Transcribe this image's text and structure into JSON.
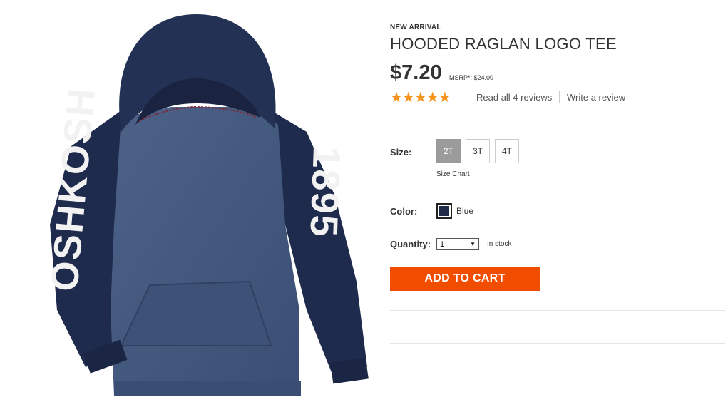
{
  "product": {
    "badge": "NEW ARRIVAL",
    "title": "HOODED RAGLAN LOGO TEE",
    "price": "$7.20",
    "msrp": "MSRP*: $24.00",
    "rating_stars": "★★★★★",
    "rating_value": 5,
    "reviews_link": "Read all 4 reviews",
    "write_review_link": "Write a review",
    "image_alt": "Navy hooded raglan logo tee with white sleeve lettering"
  },
  "size": {
    "label": "Size:",
    "options": [
      "2T",
      "3T",
      "4T"
    ],
    "selected": "2T",
    "chart_link": "Size Chart"
  },
  "color": {
    "label": "Color:",
    "value": "Blue",
    "swatch_color": "#1e2a47"
  },
  "quantity": {
    "label": "Quantity:",
    "value": "1",
    "stock_status": "In stock"
  },
  "cart": {
    "button_label": "ADD TO CART",
    "button_color": "#f14d00"
  },
  "colors": {
    "star": "#f7941d",
    "hoodie_sleeve": "#1f2b4c",
    "hoodie_body": "#445a80"
  }
}
